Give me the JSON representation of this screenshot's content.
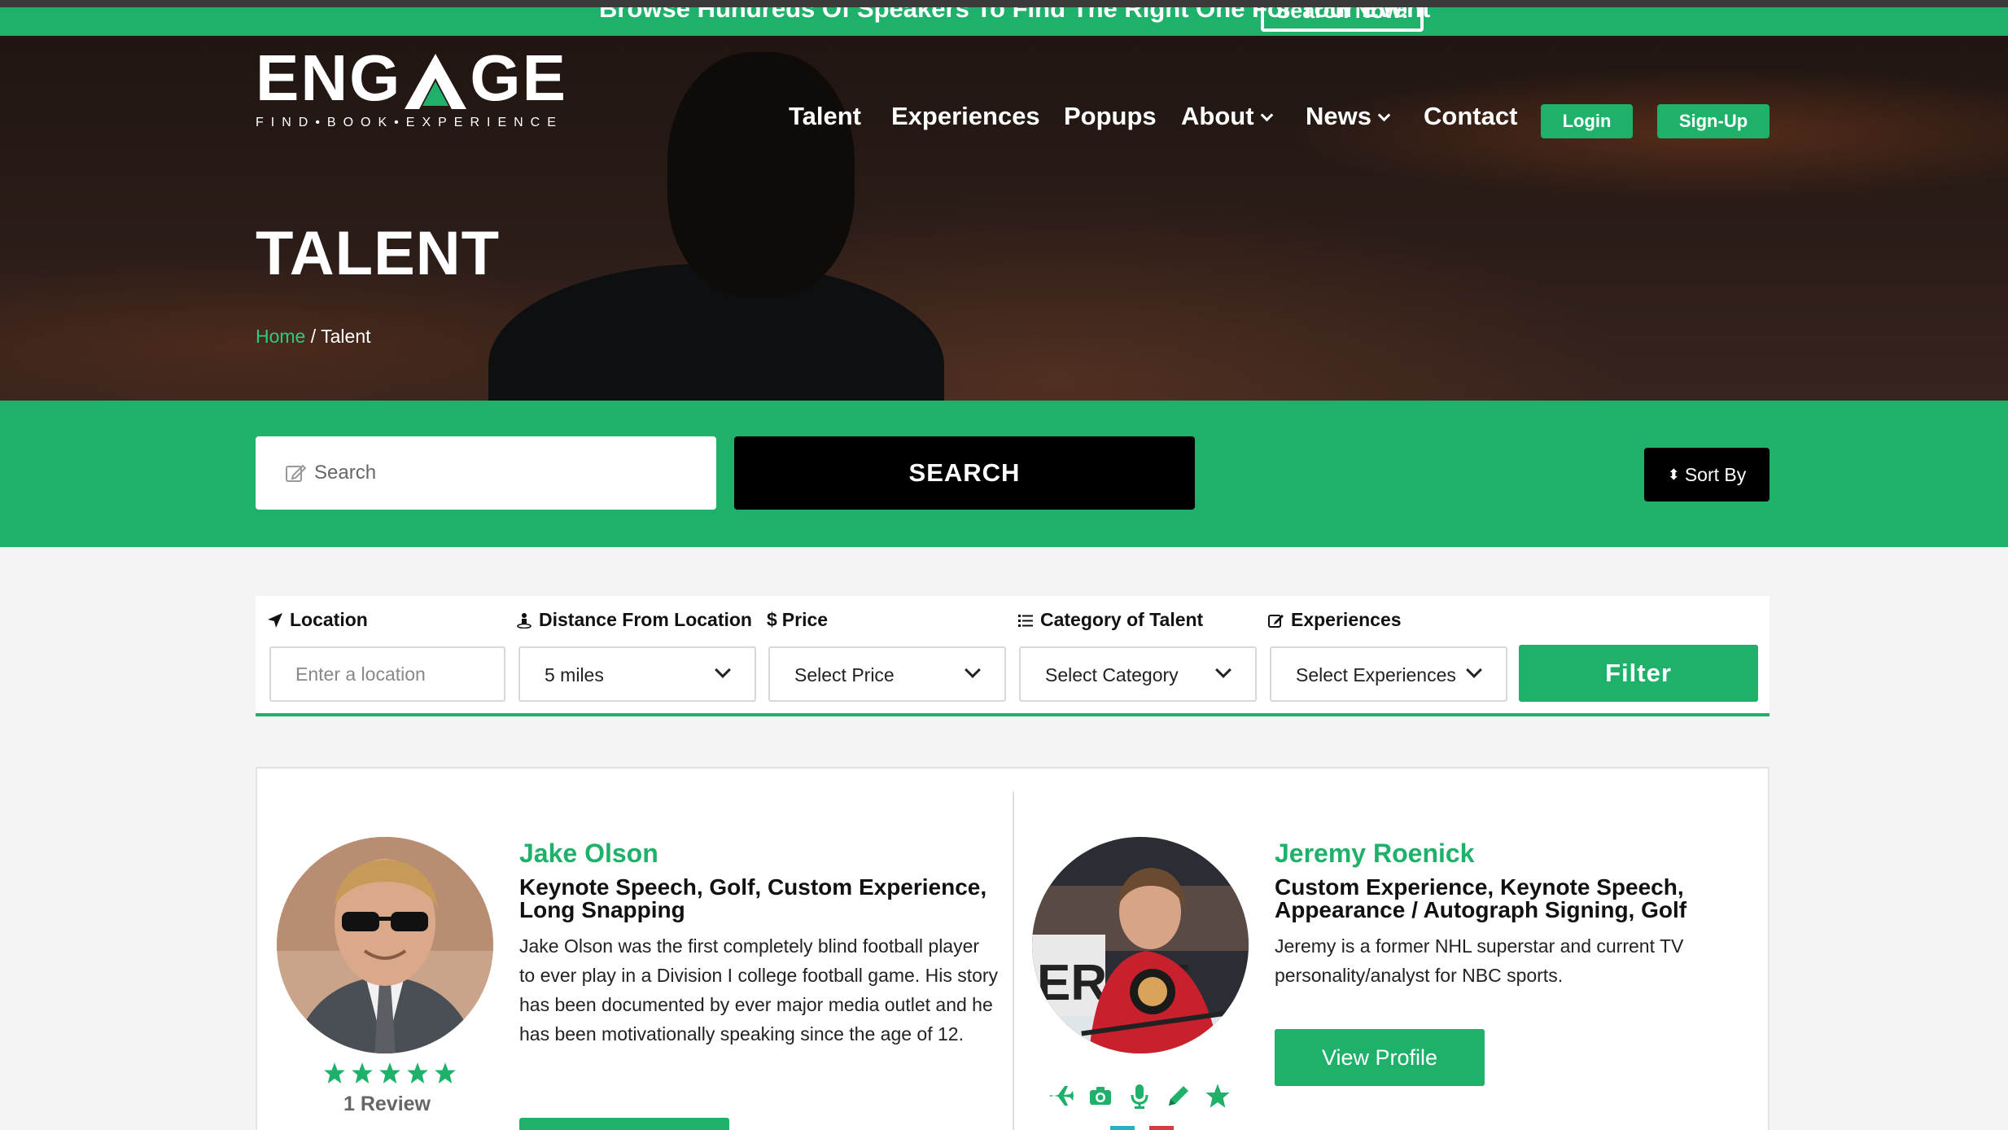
{
  "promo": {
    "text": "Browse Hundreds Of Speakers To Find The Right One For Your Event",
    "button": "Search Now!"
  },
  "brand": {
    "logo_left": "ENG",
    "logo_right": "GE",
    "tagline": "FIND•BOOK•EXPERIENCE",
    "accent": "#1fb16a"
  },
  "nav": {
    "links": [
      "Talent",
      "Experiences",
      "Popups",
      "About",
      "News",
      "Contact"
    ],
    "login": "Login",
    "signup": "Sign-Up"
  },
  "page": {
    "title": "TALENT",
    "breadcrumb_home": "Home",
    "breadcrumb_sep": " / ",
    "breadcrumb_current": "Talent"
  },
  "search": {
    "placeholder": "Search",
    "button": "SEARCH",
    "sort": "Sort By"
  },
  "filters": {
    "location_label": "Location",
    "location_placeholder": "Enter a location",
    "distance_label": "Distance From Location",
    "distance_value": "5 miles",
    "price_label": "Price",
    "price_value": "Select Price",
    "category_label": "Category of Talent",
    "category_value": "Select Category",
    "experiences_label": "Experiences",
    "experiences_value": "Select Experiences",
    "filter_button": "Filter"
  },
  "talents": [
    {
      "name": "Jake Olson",
      "tags": "Keynote Speech, Golf, Custom Experience, Long Snapping",
      "description": "Jake Olson was the first completely blind football player to ever play in a Division I college football game. His story has been documented by ever major media outlet and he has been motivationally speaking since the age of 12.",
      "rating": 5,
      "reviews": "1 Review"
    },
    {
      "name": "Jeremy Roenick",
      "tags": "Custom Experience, Keynote Speech, Appearance / Autograph Signing, Golf",
      "description": "Jeremy is a former NHL superstar and current TV personality/analyst for NBC sports.",
      "button": "View Profile",
      "experience_icons": [
        "plane-icon",
        "camera-icon",
        "microphone-icon",
        "pencil-icon",
        "star-icon"
      ]
    }
  ]
}
